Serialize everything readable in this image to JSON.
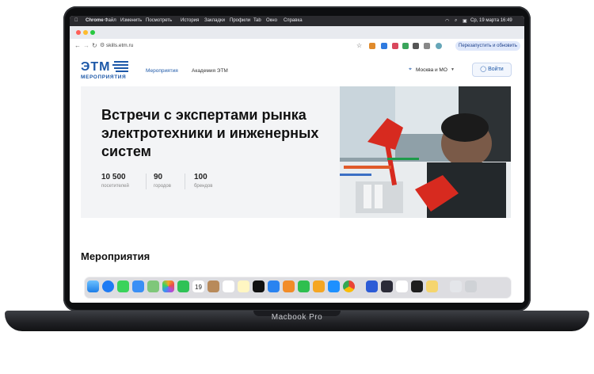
{
  "laptop": {
    "model_label": "Macbook Pro"
  },
  "menubar": {
    "items": [
      "Chrome",
      "Файл",
      "Изменить",
      "Посмотреть",
      "История",
      "Закладки",
      "Профили",
      "Tab",
      "Окно",
      "Справка"
    ],
    "datetime": "Ср, 19 марта 16:49"
  },
  "browser": {
    "url": "skills.etm.ru",
    "relaunch_label": "Перезапустить и обновить"
  },
  "site": {
    "logo_main": "ЭТМ",
    "logo_sub": "МЕРОПРИЯТИЯ",
    "nav": [
      "Мероприятия",
      "Академия ЭТМ"
    ],
    "city": "Москва и МО",
    "login_label": "Войти",
    "hero_title": "Встречи с экспертами рынка электротехники и инженерных систем",
    "stats": [
      {
        "value": "10 500",
        "label": "посетителей"
      },
      {
        "value": "90",
        "label": "городов"
      },
      {
        "value": "100",
        "label": "брендов"
      }
    ],
    "section_title": "Мероприятия"
  },
  "colors": {
    "brand": "#1d58a8",
    "hero_bg": "#f3f4f6",
    "accent_red": "#d72a1f"
  },
  "dock": {
    "apps": [
      "finder-icon",
      "safari-icon",
      "messages-icon",
      "mail-icon",
      "maps-icon",
      "photos-icon",
      "facetime-icon",
      "calendar-icon",
      "contacts-icon",
      "reminders-icon",
      "notes-icon",
      "tv-icon",
      "keynote-icon",
      "pages-icon",
      "numbers-icon",
      "pages2-icon",
      "app-store-icon",
      "chrome-icon",
      "x-icon",
      "app2-icon",
      "yandex-icon",
      "figma-icon",
      "app3-icon",
      "downloads-icon",
      "trash-icon"
    ],
    "calendar_day": "19"
  }
}
